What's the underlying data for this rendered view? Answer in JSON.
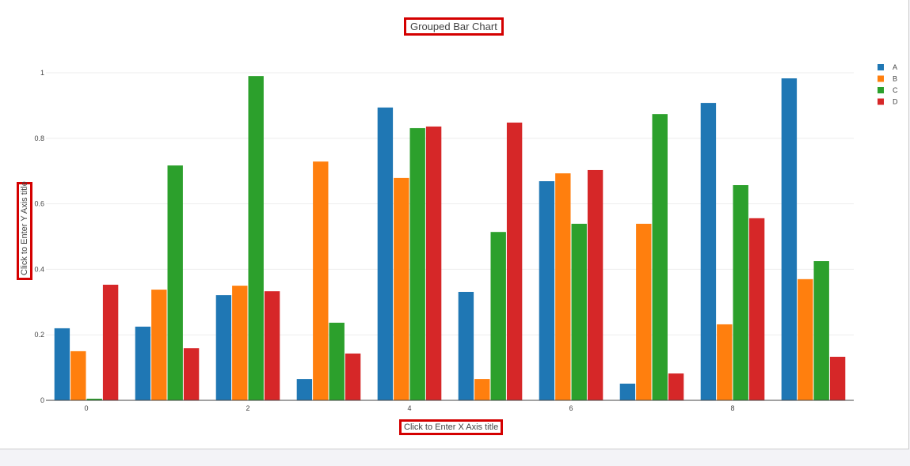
{
  "chart_data": {
    "type": "bar",
    "title": "Grouped Bar Chart",
    "xlabel": "Click to Enter X Axis title",
    "ylabel": "Click to Enter Y Axis title",
    "x": [
      0,
      1,
      2,
      3,
      4,
      5,
      6,
      7,
      8,
      9
    ],
    "xticks": [
      "0",
      "2",
      "4",
      "6",
      "8"
    ],
    "yticks": [
      "0",
      "0.2",
      "0.4",
      "0.6",
      "0.8",
      "1"
    ],
    "ylim": [
      0,
      1.0
    ],
    "xlim": [
      -0.5,
      9.5
    ],
    "grid": true,
    "legend_placement": "top-right",
    "series": [
      {
        "name": "A",
        "color": "#1f77b4",
        "values": [
          0.22,
          0.225,
          0.321,
          0.065,
          0.894,
          0.331,
          0.669,
          0.051,
          0.908,
          0.983
        ]
      },
      {
        "name": "B",
        "color": "#ff7f0e",
        "values": [
          0.15,
          0.338,
          0.35,
          0.729,
          0.679,
          0.065,
          0.693,
          0.539,
          0.232,
          0.37
        ]
      },
      {
        "name": "C",
        "color": "#2ca02c",
        "values": [
          0.005,
          0.717,
          0.99,
          0.237,
          0.831,
          0.514,
          0.539,
          0.874,
          0.657,
          0.425
        ]
      },
      {
        "name": "D",
        "color": "#d62728",
        "values": [
          0.353,
          0.159,
          0.333,
          0.143,
          0.836,
          0.848,
          0.703,
          0.082,
          0.556,
          0.133
        ]
      }
    ]
  }
}
